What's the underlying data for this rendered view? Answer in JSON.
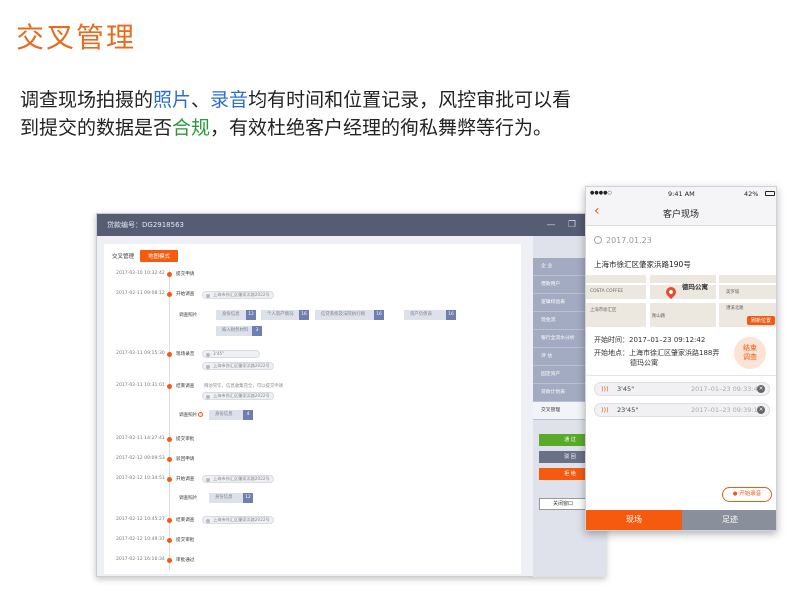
{
  "slide": {
    "title": "交叉管理",
    "desc_1": "调查现场拍摄的",
    "desc_hl_photo": "照片",
    "desc_2": "、",
    "desc_hl_audio": "录音",
    "desc_3": "均有时间和位置记录，风控审批可以看到提交的数据是否",
    "desc_hl_compliant": "合规",
    "desc_4": "，有效杜绝客户经理的徇私舞弊等行为。"
  },
  "desktop": {
    "header_title": "贷款编号：DG2918563",
    "min_icon": "—",
    "restore_icon": "❐",
    "tabs": {
      "cross": "交叉管理",
      "map_mode": "地图模式"
    },
    "timeline": [
      {
        "time": "2017-02-10 10:32:42",
        "label": "提交申请"
      },
      {
        "time": "2017-02-11 09:08:12",
        "label": "开始调查"
      },
      {
        "time": "2017-02-11 09:15:30",
        "label": "现场录音"
      },
      {
        "time": "2017-02-11 10:31:01",
        "label": "结束调查"
      },
      {
        "time": "2017-02-11 14:27:41",
        "label": "提交审批"
      },
      {
        "time": "2017-02-12 09:09:53",
        "label": "驳回申请"
      },
      {
        "time": "2017-02-12 10:34:51",
        "label": "开始调查"
      },
      {
        "time": "2017-02-12 10:45:27",
        "label": "结束调查"
      },
      {
        "time": "2017-02-12 10:49:37",
        "label": "提交审批"
      },
      {
        "time": "2017-02-12 16:16:34",
        "label": "审批通过"
      }
    ],
    "location": "上海市徐汇区肇家浜路2022号",
    "photos_label": "调查照片",
    "photo_chips": [
      {
        "name": "身份信息",
        "count": "12"
      },
      {
        "name": "个人资产情况",
        "count": "16"
      },
      {
        "name": "信贷系统及法院执行网",
        "count": "16"
      },
      {
        "name": "资产负债表",
        "count": "16"
      },
      {
        "name": "嫁入财务材料",
        "count": "3"
      }
    ],
    "audio_duration": "3'45\"",
    "end_note": "拜访完毕，信息收集完全，可以提交申请",
    "photos_label_2": "调查照片",
    "warn_mark": "!",
    "id_chip_2": {
      "name": "身份信息",
      "count": "4"
    },
    "photos_label_3": "调查照片",
    "id_chip_3": {
      "name": "身份信息",
      "count": "12"
    },
    "sidebar": [
      "企 业",
      "借款用户",
      "逻辑校验表",
      "现金流",
      "银行全流水分析",
      "评 估",
      "固定资产",
      "贷款计划表",
      "交叉管理"
    ],
    "btn_pass": "通 过",
    "btn_reject": "驳 回",
    "btn_refuse": "拒 绝",
    "btn_close": "关闭窗口",
    "colors": {
      "orange": "#f55a0f",
      "green": "#5aaa2a",
      "gray": "#6a7186",
      "header": "#555d72"
    }
  },
  "phone": {
    "status_time": "9:41 AM",
    "battery": "42%",
    "signal_icon": "●●●●○",
    "nav_title": "客户现场",
    "back_icon": "‹",
    "date": "2017.01.23",
    "address": "上海市徐汇区肇家浜路190号",
    "map_poi": "德玛公寓",
    "map_refresh": "刷新位置",
    "map_labels": [
      "COSTA COFFEE",
      "上海市徐汇区",
      "美罗城",
      "衡山路",
      "漕溪北路"
    ],
    "start_label": "开始时间：",
    "start_time": "2017–01–23  09:12:42",
    "loc_label": "开始地点：",
    "loc_value_1": "上海市徐汇区肇家浜路188弄",
    "loc_value_2": "德玛公寓",
    "end_btn_1": "结束",
    "end_btn_2": "调查",
    "recordings": [
      {
        "duration": "3'45\"",
        "time": "2017–01–23  09:33:42"
      },
      {
        "duration": "23'45\"",
        "time": "2017–01–23  09:39:13"
      }
    ],
    "start_rec": "开始录音",
    "tab_site": "现场",
    "tab_footprint": "足迹"
  }
}
